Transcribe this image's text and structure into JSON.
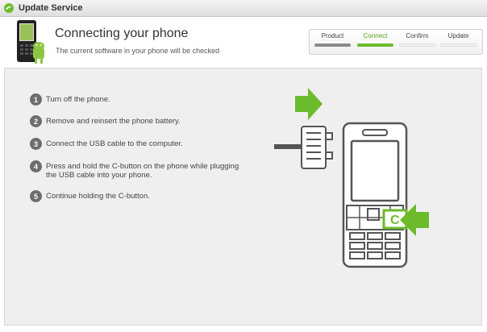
{
  "window": {
    "title": "Update Service",
    "title_icon": "sony-ericsson-logo-icon"
  },
  "header": {
    "title": "Connecting your phone",
    "subtitle": "The current software in your phone will be checked",
    "image_icon": "phone-with-android-icon"
  },
  "progress_steps": [
    {
      "label": "Product",
      "state": "done"
    },
    {
      "label": "Connect",
      "state": "current"
    },
    {
      "label": "Confirm",
      "state": "todo"
    },
    {
      "label": "Update",
      "state": "todo"
    }
  ],
  "instructions": [
    {
      "number": "1",
      "text": "Turn off the phone."
    },
    {
      "number": "2",
      "text": "Remove and reinsert the phone battery."
    },
    {
      "number": "3",
      "text": "Connect the USB cable to the computer."
    },
    {
      "number": "4",
      "text": "Press and hold the C-button on the phone while plugging the USB cable into your phone."
    },
    {
      "number": "5",
      "text": "Continue holding the C-button."
    }
  ],
  "illustration": {
    "c_button_label": "C",
    "accent_color": "#6cbb2c"
  },
  "colors": {
    "accent": "#6cbb2c",
    "step_done": "#8a8a8a",
    "number_badge": "#6e6e6e"
  }
}
